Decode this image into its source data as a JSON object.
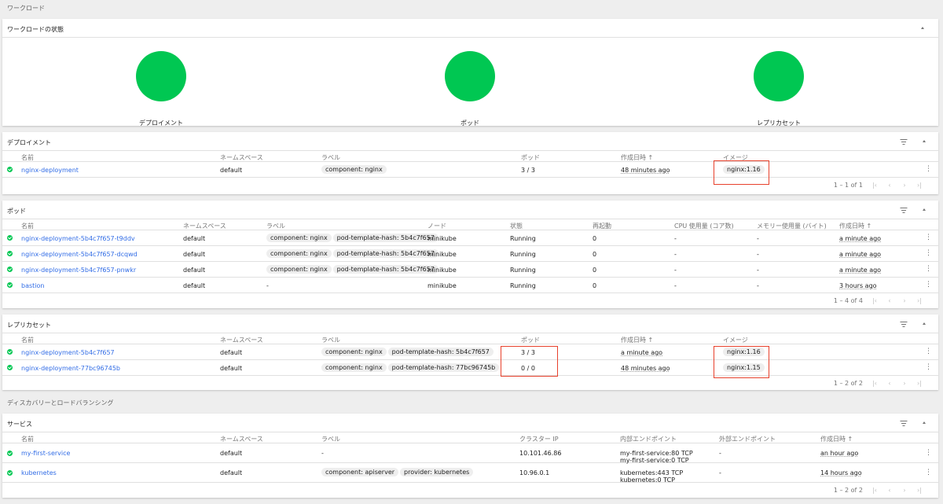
{
  "workloads": {
    "section_title": "ワークロード",
    "status": {
      "title": "ワークロードの状態",
      "items": [
        {
          "label": "デプロイメント"
        },
        {
          "label": "ポッド"
        },
        {
          "label": "レプリカセット"
        }
      ],
      "circle_color": "#00c752"
    },
    "deployments": {
      "title": "デプロイメント",
      "headers": {
        "name": "名前",
        "namespace": "ネームスペース",
        "labels": "ラベル",
        "pods": "ポッド",
        "created": "作成日時",
        "sort_arrow": "↑",
        "images": "イメージ"
      },
      "rows": [
        {
          "name": "nginx-deployment",
          "namespace": "default",
          "labels": [
            "component: nginx"
          ],
          "pods": "3 / 3",
          "created": "48 minutes ago",
          "image": "nginx:1.16"
        }
      ],
      "pagination": "1 – 1 of 1"
    },
    "pods": {
      "title": "ポッド",
      "headers": {
        "name": "名前",
        "namespace": "ネームスペース",
        "labels": "ラベル",
        "node": "ノード",
        "status": "状態",
        "restarts": "再起動",
        "cpu": "CPU 使用量 (コア数)",
        "memory": "メモリー使用量 (バイト)",
        "created": "作成日時",
        "sort_arrow": "↑"
      },
      "rows": [
        {
          "name": "nginx-deployment-5b4c7f657-t9ddv",
          "namespace": "default",
          "labels": [
            "component: nginx",
            "pod-template-hash: 5b4c7f657"
          ],
          "node": "minikube",
          "status": "Running",
          "restarts": "0",
          "cpu": "-",
          "memory": "-",
          "created": "a minute ago"
        },
        {
          "name": "nginx-deployment-5b4c7f657-dcqwd",
          "namespace": "default",
          "labels": [
            "component: nginx",
            "pod-template-hash: 5b4c7f657"
          ],
          "node": "minikube",
          "status": "Running",
          "restarts": "0",
          "cpu": "-",
          "memory": "-",
          "created": "a minute ago"
        },
        {
          "name": "nginx-deployment-5b4c7f657-pnwkr",
          "namespace": "default",
          "labels": [
            "component: nginx",
            "pod-template-hash: 5b4c7f657"
          ],
          "node": "minikube",
          "status": "Running",
          "restarts": "0",
          "cpu": "-",
          "memory": "-",
          "created": "a minute ago"
        },
        {
          "name": "bastion",
          "namespace": "default",
          "labels_text": "-",
          "node": "minikube",
          "status": "Running",
          "restarts": "0",
          "cpu": "-",
          "memory": "-",
          "created": "3 hours ago"
        }
      ],
      "pagination": "1 – 4 of 4"
    },
    "replicasets": {
      "title": "レプリカセット",
      "headers": {
        "name": "名前",
        "namespace": "ネームスペース",
        "labels": "ラベル",
        "pods": "ポッド",
        "created": "作成日時",
        "sort_arrow": "↑",
        "images": "イメージ"
      },
      "rows": [
        {
          "name": "nginx-deployment-5b4c7f657",
          "namespace": "default",
          "labels": [
            "component: nginx",
            "pod-template-hash: 5b4c7f657"
          ],
          "pods": "3 / 3",
          "created": "a minute ago",
          "image": "nginx:1.16"
        },
        {
          "name": "nginx-deployment-77bc96745b",
          "namespace": "default",
          "labels": [
            "component: nginx",
            "pod-template-hash: 77bc96745b"
          ],
          "pods": "0 / 0",
          "created": "48 minutes ago",
          "image": "nginx:1.15"
        }
      ],
      "pagination": "1 – 2 of 2"
    }
  },
  "discovery": {
    "section_title": "ディスカバリーとロードバランシング",
    "services": {
      "title": "サービス",
      "headers": {
        "name": "名前",
        "namespace": "ネームスペース",
        "labels": "ラベル",
        "cluster_ip": "クラスター IP",
        "internal_endpoints": "内部エンドポイント",
        "external_endpoints": "外部エンドポイント",
        "created": "作成日時",
        "sort_arrow": "↑"
      },
      "rows": [
        {
          "name": "my-first-service",
          "namespace": "default",
          "labels_text": "-",
          "cluster_ip": "10.101.46.86",
          "internal_endpoints": [
            "my-first-service:80 TCP",
            "my-first-service:0 TCP"
          ],
          "external_endpoints": "-",
          "created": "an hour ago"
        },
        {
          "name": "kubernetes",
          "namespace": "default",
          "labels": [
            "component: apiserver",
            "provider: kubernetes"
          ],
          "cluster_ip": "10.96.0.1",
          "internal_endpoints": [
            "kubernetes:443 TCP",
            "kubernetes:0 TCP"
          ],
          "external_endpoints": "-",
          "created": "14 hours ago"
        }
      ],
      "pagination": "1 – 2 of 2"
    }
  },
  "icons": {
    "status_ok": "check-circle-icon",
    "filter": "filter-icon",
    "collapse": "chevron-up-icon",
    "more": "more-vert-icon",
    "first_page": "first-page-icon",
    "prev_page": "chevron-left-icon",
    "next_page": "chevron-right-icon",
    "last_page": "last-page-icon"
  },
  "glyphs": {
    "more": "⋮",
    "first": "|‹",
    "prev": "‹",
    "next": "›",
    "last": "›|"
  },
  "colors": {
    "link": "#326de6",
    "ok": "#00c752",
    "highlight": "#e8412c"
  }
}
